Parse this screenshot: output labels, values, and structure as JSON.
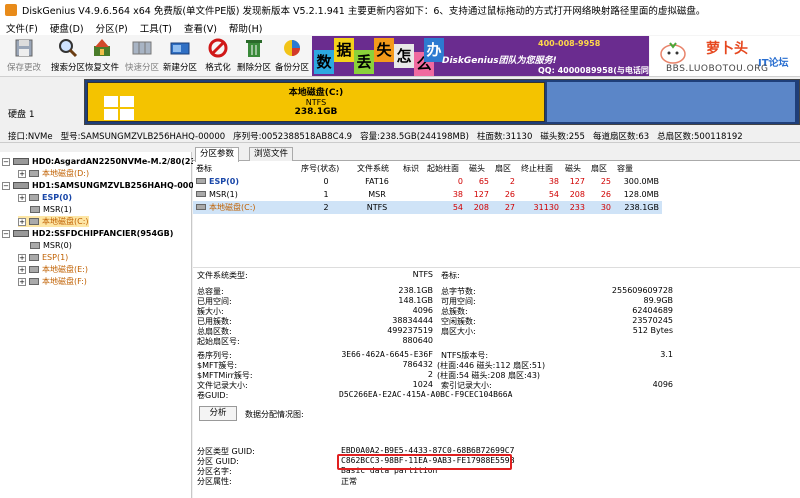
{
  "window": {
    "title": "DiskGenius V4.9.6.564 x64 免费版(单文件PE版)  发现新版本 V5.2.1.941 主要更新内容如下：6、支持通过鼠标拖动的方式打开网络映射路径里面的虚拟磁盘。"
  },
  "menu": [
    "文件(F)",
    "硬盘(D)",
    "分区(P)",
    "工具(T)",
    "查看(V)",
    "帮助(H)"
  ],
  "toolbar": [
    {
      "label": "保存更改",
      "icon": "save-icon",
      "enabled": false
    },
    {
      "label": "搜索分区",
      "icon": "search-icon",
      "enabled": true
    },
    {
      "label": "恢复文件",
      "icon": "recover-icon",
      "enabled": true
    },
    {
      "label": "快速分区",
      "icon": "quick-partition-icon",
      "enabled": false
    },
    {
      "label": "新建分区",
      "icon": "new-partition-icon",
      "enabled": true
    },
    {
      "label": "格式化",
      "icon": "format-icon",
      "enabled": true
    },
    {
      "label": "删除分区",
      "icon": "delete-icon",
      "enabled": true
    },
    {
      "label": "备份分区",
      "icon": "backup-icon",
      "enabled": true
    }
  ],
  "banner": {
    "blocks": [
      "数",
      "据",
      "丢",
      "失",
      "怎",
      "么",
      "办"
    ],
    "phone": "400-008-9958",
    "team": "DiskGenius团队为您服务!",
    "qq": "QQ: 4000089958(与电话同号)"
  },
  "logo": {
    "name": "萝卜头",
    "it": "IT论坛",
    "url": "BBS.LUOBOTOU.ORG"
  },
  "diskmap": {
    "disk_label": "硬盘 1",
    "selected": {
      "name": "本地磁盘(C:)",
      "fs": "NTFS",
      "size": "238.1GB"
    }
  },
  "infoline": [
    "接口:NVMe",
    "型号:SAMSUNGMZVLB256HAHQ-00000",
    "序列号:0052388518AB8C4.9",
    "容量:238.5GB(244198MB)",
    "柱面数:31130",
    "磁头数:255",
    "每道扇区数:63",
    "总扇区数:500118192"
  ],
  "tree": [
    {
      "text": "HD0:AsgardAN2250NVMe-M.2/80(233G",
      "level": 0,
      "kind": "disk",
      "toggle": "-"
    },
    {
      "text": "本地磁盘(D:)",
      "level": 1,
      "kind": "orange",
      "toggle": "+"
    },
    {
      "text": "HD1:SAMSUNGMZVLB256HAHQ-00000(23",
      "level": 0,
      "kind": "disk",
      "toggle": "-"
    },
    {
      "text": "ESP(0)",
      "level": 1,
      "kind": "blue",
      "toggle": "+"
    },
    {
      "text": "MSR(1)",
      "level": 1,
      "kind": "plain",
      "toggle": ""
    },
    {
      "text": "本地磁盘(C:)",
      "level": 1,
      "kind": "orange",
      "toggle": "+",
      "selected": true
    },
    {
      "text": "HD2:SSFDCHIPFANCIER(954GB)",
      "level": 0,
      "kind": "disk",
      "toggle": "-"
    },
    {
      "text": "MSR(0)",
      "level": 1,
      "kind": "plain",
      "toggle": ""
    },
    {
      "text": "ESP(1)",
      "level": 1,
      "kind": "blue-orange",
      "toggle": "+"
    },
    {
      "text": "本地磁盘(E:)",
      "level": 1,
      "kind": "orange",
      "toggle": "+"
    },
    {
      "text": "本地磁盘(F:)",
      "level": 1,
      "kind": "orange",
      "toggle": "+"
    }
  ],
  "tabs": [
    "分区参数",
    "浏览文件"
  ],
  "table": {
    "headers": [
      "卷标",
      "序号(状态)",
      "文件系统",
      "标识",
      "起始柱面",
      "磁头",
      "扇区",
      "终止柱面",
      "磁头",
      "扇区",
      "容量"
    ],
    "rows": [
      {
        "label": "ESP(0)",
        "seq": "0",
        "fs": "FAT16",
        "id": "",
        "sc": "0",
        "sh": "65",
        "ss": "2",
        "ec": "38",
        "eh": "127",
        "es": "25",
        "size": "300.0MB",
        "cls": "blue"
      },
      {
        "label": "MSR(1)",
        "seq": "1",
        "fs": "MSR",
        "id": "",
        "sc": "38",
        "sh": "127",
        "ss": "26",
        "ec": "54",
        "eh": "208",
        "es": "26",
        "size": "128.0MB",
        "cls": "plain"
      },
      {
        "label": "本地磁盘(C:)",
        "seq": "2",
        "fs": "NTFS",
        "id": "",
        "sc": "54",
        "sh": "208",
        "ss": "27",
        "ec": "31130",
        "eh": "233",
        "es": "30",
        "size": "238.1GB",
        "cls": "orange",
        "selected": true
      }
    ]
  },
  "details": {
    "fs_type_label": "文件系统类型:",
    "fs_type": "NTFS",
    "vol_label": "卷标:",
    "left": [
      {
        "k": "总容量:",
        "v": "238.1GB"
      },
      {
        "k": "已用空间:",
        "v": "148.1GB"
      },
      {
        "k": "簇大小:",
        "v": "4096"
      },
      {
        "k": "已用簇数:",
        "v": "38834444"
      },
      {
        "k": "总扇区数:",
        "v": "499237519"
      },
      {
        "k": "起始扇区号:",
        "v": "880640"
      }
    ],
    "right": [
      {
        "k": "总字节数:",
        "v": "255609609728"
      },
      {
        "k": "可用空间:",
        "v": "89.9GB"
      },
      {
        "k": "总簇数:",
        "v": "62404689"
      },
      {
        "k": "空闲簇数:",
        "v": "23570245"
      },
      {
        "k": "扇区大小:",
        "v": "512 Bytes"
      }
    ],
    "vol_serial_label": "卷序列号:",
    "vol_serial": "3E66-462A-6645-E36F",
    "ntfs_ver_label": "NTFS版本号:",
    "ntfs_ver": "3.1",
    "mft_label": "$MFT簇号:",
    "mft": "786432",
    "mft_pos": "(柱面:446 磁头:112 扇区:51)",
    "mftmirr_label": "$MFTMirr簇号:",
    "mftmirr": "2",
    "mftmirr_pos": "(柱面:54 磁头:208 扇区:43)",
    "record_label": "文件记录大小:",
    "record": "1024",
    "index_label": "索引记录大小:",
    "index": "4096",
    "vguid_label": "卷GUID:",
    "vguid": "D5C266EA-E2AC-415A-A0BC-F9CEC104B66A",
    "analyze_btn": "分析",
    "usage_label": "数据分配情况图:",
    "ptype_guid_label": "分区类型 GUID:",
    "ptype_guid": "EBD0A0A2-B9E5-4433-87C0-68B6B72699C7",
    "pguid_label": "分区 GUID:",
    "pguid": "C862BCC3-98BF-11EA-9AB3-FE17988E559B",
    "pname_label": "分区名字:",
    "pname": "Basic data partition",
    "pattr_label": "分区属性:",
    "pattr": "正常"
  },
  "colors": {
    "accent_red": "#e02020",
    "selected_orange": "#f4c300",
    "disk_blue": "#1f3f7a"
  }
}
